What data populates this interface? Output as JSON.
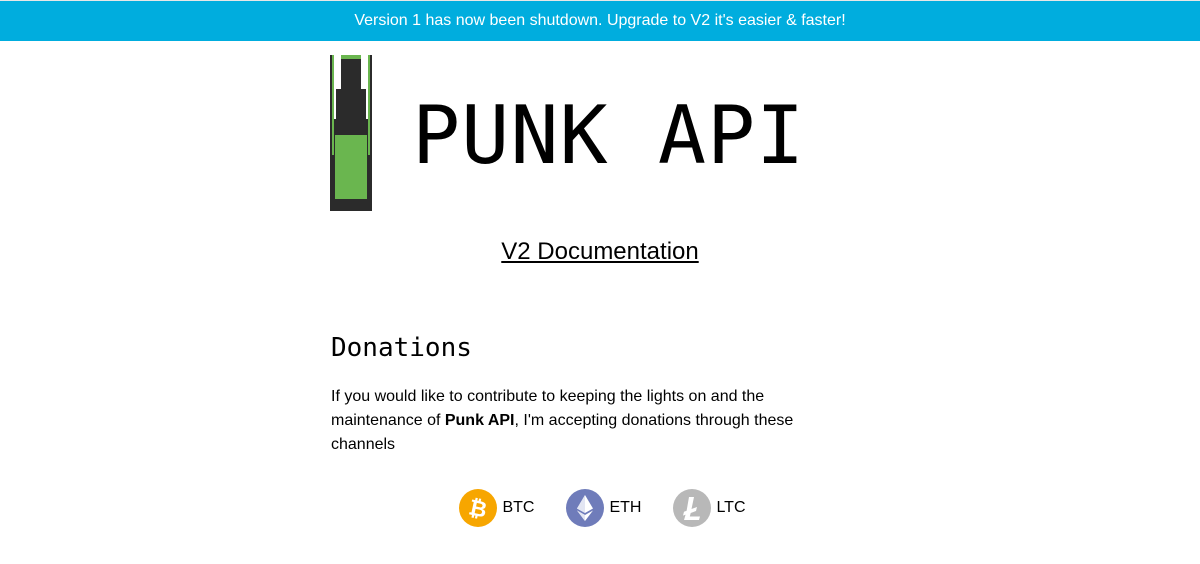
{
  "banner": {
    "text": "Version 1 has now been shutdown. Upgrade to V2 it's easier & faster!"
  },
  "logo": {
    "text": "PUNK API",
    "bottle_color": "#6AB64F",
    "bottle_dark": "#2B2B2B"
  },
  "docs": {
    "link_text": "V2 Documentation"
  },
  "donations": {
    "title": "Donations",
    "text_before": "If you would like to contribute to keeping the lights on and the maintenance of ",
    "bold": "Punk API",
    "text_after": ", I'm accepting donations through these channels"
  },
  "coins": [
    {
      "label": "BTC",
      "icon": "bitcoin-icon",
      "color": "#F7A600"
    },
    {
      "label": "ETH",
      "icon": "ethereum-icon",
      "color": "#6F7CBA"
    },
    {
      "label": "LTC",
      "icon": "litecoin-icon",
      "color": "#B8B8B8"
    }
  ]
}
